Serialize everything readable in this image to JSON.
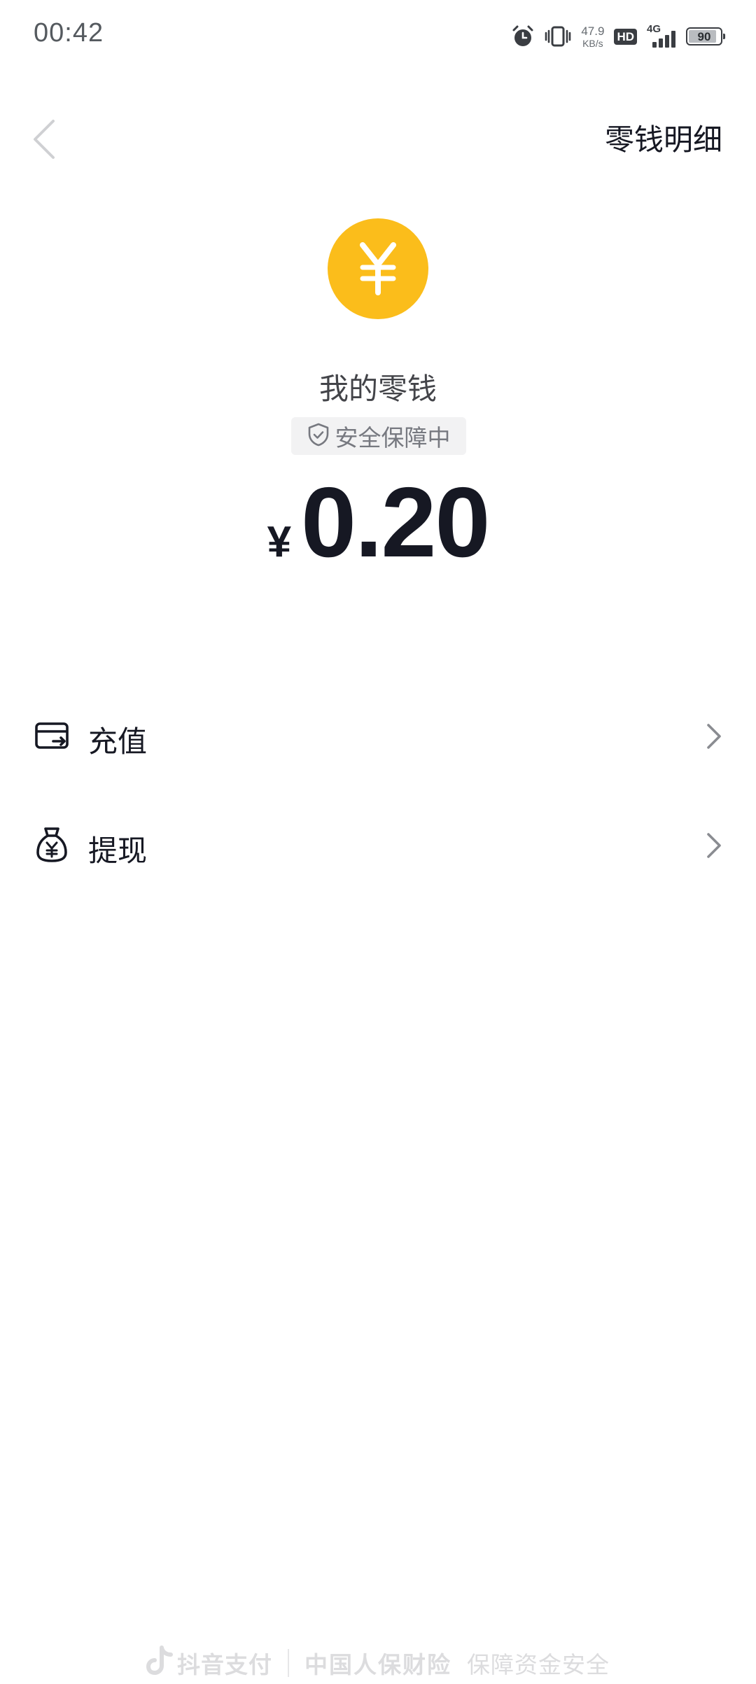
{
  "status_bar": {
    "time": "00:42",
    "net_speed_value": "47.9",
    "net_speed_unit": "KB/s",
    "hd_label": "HD",
    "network_type": "4G",
    "battery_level": "90",
    "icons": [
      "alarm-icon",
      "vibrate-icon",
      "hd-icon",
      "signal-icon",
      "battery-icon"
    ]
  },
  "nav": {
    "back_icon": "chevron-left-icon",
    "details_label": "零钱明细"
  },
  "wallet": {
    "coin_icon": "yen-coin-icon",
    "title": "我的零钱",
    "security_badge": "安全保障中",
    "currency_symbol": "¥",
    "balance": "0.20"
  },
  "menu": {
    "items": [
      {
        "label": "充值",
        "icon": "card-recharge-icon"
      },
      {
        "label": "提现",
        "icon": "money-bag-icon"
      }
    ]
  },
  "footer": {
    "brand": "抖音支付",
    "partner": "中国人保财险",
    "slogan": "保障资金安全"
  },
  "colors": {
    "accent": "#fbbd1b",
    "text_primary": "#161823",
    "text_secondary": "#777980",
    "badge_bg": "#f2f2f3",
    "footer_text": "#dcdcde"
  }
}
